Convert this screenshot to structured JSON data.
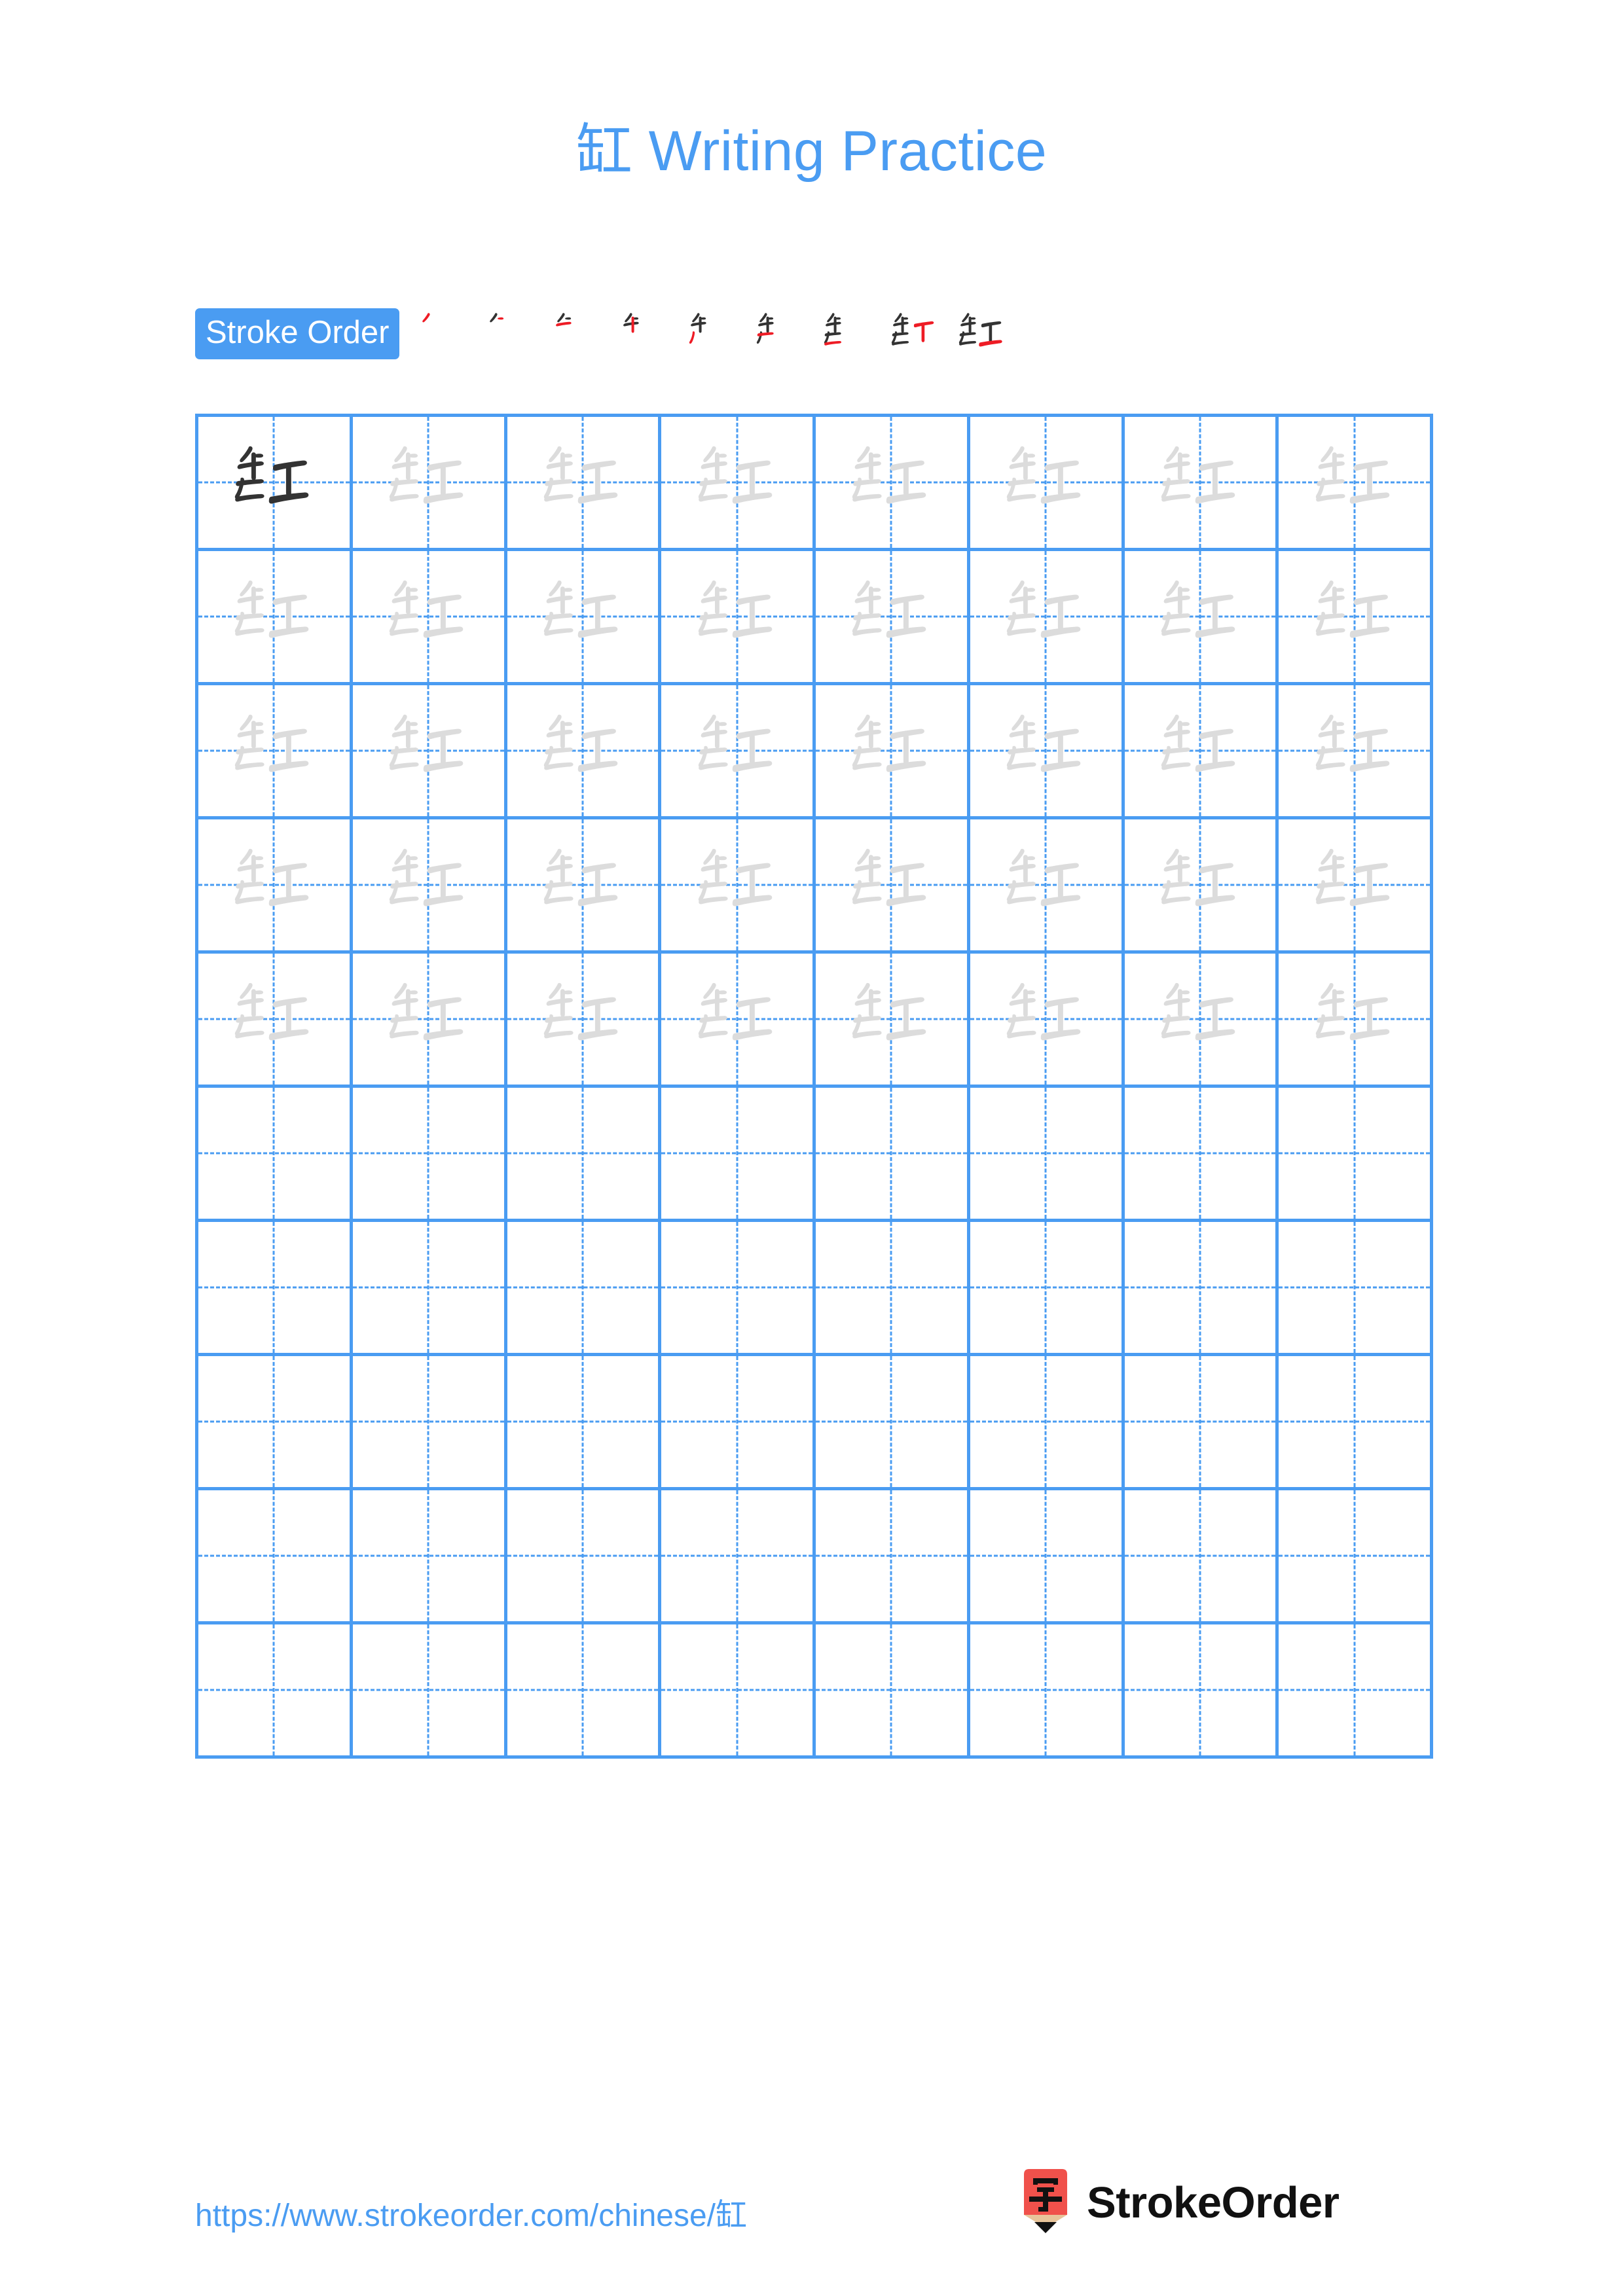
{
  "document": {
    "character": "缸",
    "title": "缸 Writing Practice",
    "type": "chinese-character-writing-practice-worksheet"
  },
  "theme": {
    "accent_blue": "#4a9cf2",
    "grid_line": "#4a9cf2",
    "trace_gray": "#dcdcdc",
    "ink_black": "#333333",
    "new_stroke_red": "#ee1c25",
    "logo_red": "#f0514b",
    "logo_wood": "#e8c49a"
  },
  "stroke_order": {
    "label": "Stroke Order",
    "total_strokes": 9,
    "steps": [
      {
        "index": 1,
        "drawn": 1,
        "new_stroke": 1
      },
      {
        "index": 2,
        "drawn": 2,
        "new_stroke": 2
      },
      {
        "index": 3,
        "drawn": 3,
        "new_stroke": 3
      },
      {
        "index": 4,
        "drawn": 4,
        "new_stroke": 4
      },
      {
        "index": 5,
        "drawn": 5,
        "new_stroke": 5
      },
      {
        "index": 6,
        "drawn": 6,
        "new_stroke": 6
      },
      {
        "index": 7,
        "drawn": 7,
        "new_stroke": 7
      },
      {
        "index": 8,
        "drawn": 8,
        "new_stroke": 8
      },
      {
        "index": 9,
        "drawn": 9,
        "new_stroke": 9
      }
    ]
  },
  "practice_grid": {
    "columns": 8,
    "rows": 10,
    "cell_style": "tian-zi-ge",
    "rows_data": [
      [
        "dark",
        "trace",
        "trace",
        "trace",
        "trace",
        "trace",
        "trace",
        "trace"
      ],
      [
        "trace",
        "trace",
        "trace",
        "trace",
        "trace",
        "trace",
        "trace",
        "trace"
      ],
      [
        "trace",
        "trace",
        "trace",
        "trace",
        "trace",
        "trace",
        "trace",
        "trace"
      ],
      [
        "trace",
        "trace",
        "trace",
        "trace",
        "trace",
        "trace",
        "trace",
        "trace"
      ],
      [
        "trace",
        "trace",
        "trace",
        "trace",
        "trace",
        "trace",
        "trace",
        "trace"
      ],
      [
        "empty",
        "empty",
        "empty",
        "empty",
        "empty",
        "empty",
        "empty",
        "empty"
      ],
      [
        "empty",
        "empty",
        "empty",
        "empty",
        "empty",
        "empty",
        "empty",
        "empty"
      ],
      [
        "empty",
        "empty",
        "empty",
        "empty",
        "empty",
        "empty",
        "empty",
        "empty"
      ],
      [
        "empty",
        "empty",
        "empty",
        "empty",
        "empty",
        "empty",
        "empty",
        "empty"
      ],
      [
        "empty",
        "empty",
        "empty",
        "empty",
        "empty",
        "empty",
        "empty",
        "empty"
      ]
    ]
  },
  "footer": {
    "url": "https://www.strokeorder.com/chinese/缸",
    "brand_name": "StrokeOrder",
    "logo_character": "字"
  }
}
